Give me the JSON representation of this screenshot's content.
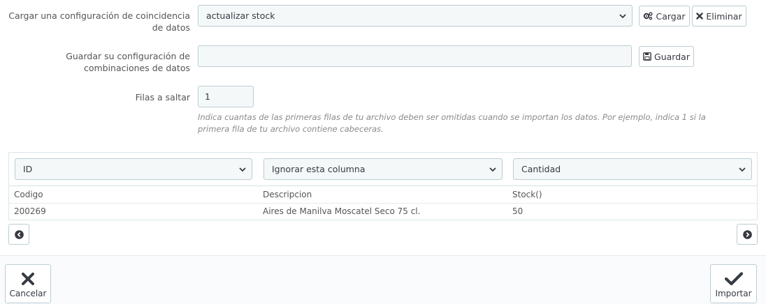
{
  "form": {
    "load_config": {
      "label": "Cargar una configuración de coincidencia de datos",
      "selected": "actualizar stock",
      "load_button": "Cargar",
      "delete_button": "Eliminar"
    },
    "save_config": {
      "label": "Guardar su configuración de combinaciones de datos",
      "value": "",
      "save_button": "Guardar"
    },
    "skip_rows": {
      "label": "Filas a saltar",
      "value": "1",
      "help": "Indica cuantas de las primeras filas de tu archivo deben ser omitidas cuando se importan los datos. Por ejemplo, indica 1 si la primera fila de tu archivo contiene cabeceras."
    }
  },
  "mapping": {
    "column_selects": [
      "ID",
      "Ignorar esta columna",
      "Cantidad"
    ],
    "headers": [
      "Codigo",
      "Descripcion",
      "Stock()"
    ],
    "rows": [
      [
        "200269",
        "Aires de Manilva Moscatel Seco 75 cl.",
        "50"
      ]
    ]
  },
  "footer": {
    "cancel": "Cancelar",
    "import": "Importar"
  },
  "icons": {
    "cogs": "cogs-icon",
    "times": "times-icon",
    "save": "floppy-icon",
    "prev": "circle-chevron-left-icon",
    "next": "circle-chevron-right-icon",
    "cancel": "close-icon",
    "import": "check-icon"
  }
}
